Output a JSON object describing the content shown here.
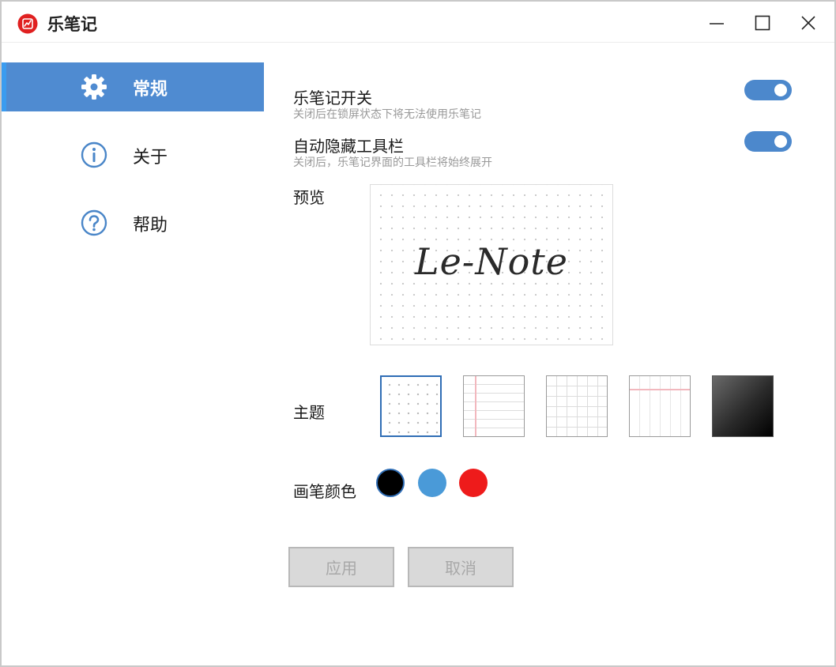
{
  "app": {
    "title": "乐笔记",
    "logo_color": "#e02020"
  },
  "window_controls": {
    "minimize": "minimize-icon",
    "maximize": "maximize-icon",
    "close": "close-icon"
  },
  "sidebar": {
    "items": [
      {
        "label": "常规",
        "icon": "gear-icon",
        "active": true
      },
      {
        "label": "关于",
        "icon": "info-icon",
        "active": false
      },
      {
        "label": "帮助",
        "icon": "help-icon",
        "active": false
      }
    ]
  },
  "settings": {
    "lock_screen_switch": {
      "title": "乐笔记开关",
      "description": "关闭后在锁屏状态下将无法使用乐笔记",
      "on": true
    },
    "auto_hide_toolbar": {
      "title": "自动隐藏工具栏",
      "description": "关闭后，乐笔记界面的工具栏将始终展开",
      "on": true
    }
  },
  "preview": {
    "label": "预览",
    "sample_text": "Le-Note"
  },
  "theme": {
    "label": "主题",
    "options": [
      "dots",
      "ruled-margin",
      "grid",
      "header-ruled",
      "dark"
    ],
    "selected": "dots"
  },
  "pen_color": {
    "label": "画笔颜色",
    "options": [
      "#000000",
      "#4a9ad8",
      "#ee1b1b"
    ],
    "selected": "#000000"
  },
  "actions": {
    "apply_label": "应用",
    "cancel_label": "取消"
  },
  "colors": {
    "accent": "#4f8bd1",
    "toggle_on": "#4c88cc"
  }
}
